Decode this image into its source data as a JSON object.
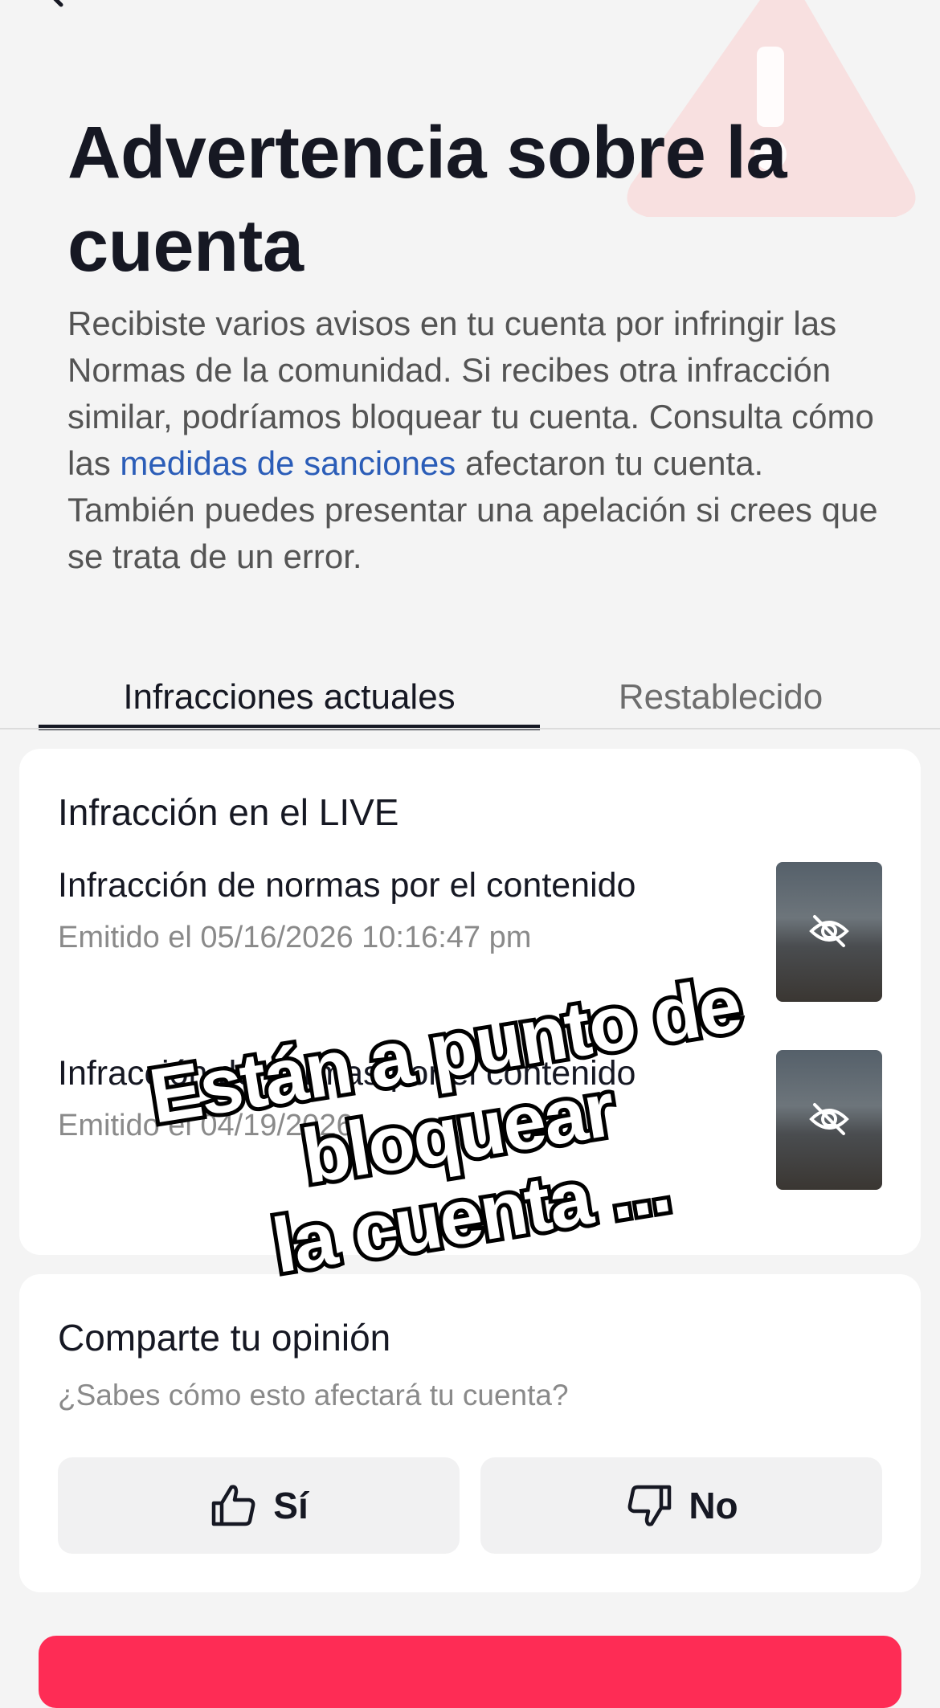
{
  "header": {
    "title": "Advertencia sobre la cuenta",
    "description_part1": "Recibiste varios avisos en tu cuenta por infringir las Normas de la comunidad. Si recibes otra infracción similar, podríamos bloquear tu cuenta. Consulta cómo las ",
    "description_link": "medidas de sanciones",
    "description_part2": " afectaron tu cuenta. También puedes presentar una apelación si crees que se trata de un error."
  },
  "tabs": [
    {
      "label": "Infracciones actuales",
      "active": true
    },
    {
      "label": "Restablecido",
      "active": false
    }
  ],
  "violations": {
    "heading": "Infracción en el LIVE",
    "items": [
      {
        "title": "Infracción de normas por el contenido",
        "date": "Emitido el 05/16/2026 10:16:47 pm",
        "thumb_icon": "eye-off-icon"
      },
      {
        "title": "Infracción de normas por el contenido",
        "date": "Emitido el 04/19/2026 ",
        "thumb_icon": "eye-off-icon"
      }
    ]
  },
  "feedback": {
    "heading": "Comparte tu opinión",
    "question": "¿Sabes cómo esto afectará tu cuenta?",
    "yes_label": "Sí",
    "no_label": "No"
  },
  "overlay": {
    "line1": "Están a punto de bloquear",
    "line2": "la cuenta ..."
  },
  "colors": {
    "accent": "#fe2c55",
    "link": "#2b5db8",
    "background": "#f4f4f4",
    "warning_bg": "#f7dada"
  }
}
